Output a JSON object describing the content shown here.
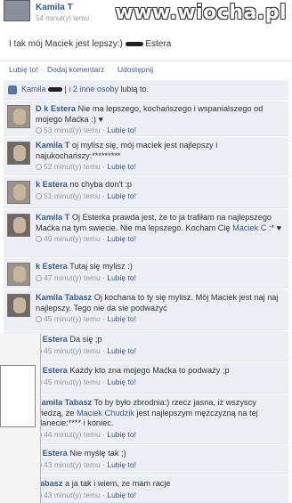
{
  "post": {
    "author": "Kamila T",
    "time": "54 minut(y) temu",
    "text_before": "I tak mój Maciek jest lepszy:)",
    "text_after": "Estera"
  },
  "watermark": "www.wiocha.pl",
  "actions": {
    "like": "Lubię to!",
    "comment": "Dodaj komentarz",
    "share": "Udostępnij"
  },
  "likes": {
    "name": "Kamila",
    "rest": "i 2 inne osoby",
    "suffix": "lubią to."
  },
  "comments": [
    {
      "name": "D     k Estera",
      "text": "Nie ma lepszego, kochańszego i wspanialszego od mojego Maćka :) ♥",
      "time": "53 minut(y) temu",
      "like": "Lubię to!"
    },
    {
      "name": "Kamila T",
      "text": "oj mylisz się, mój maciek jest najlepszy i najukochańszy:*********",
      "time": "52 minut(y) temu",
      "like": "Lubię to!"
    },
    {
      "name": "k Estera",
      "text": "no chyba don't :p",
      "time": "51 minut(y) temu",
      "like": "Lubię to!"
    },
    {
      "name": "Kamila T",
      "text": "Oj Esterka prawda jest, że to ja trafiłam na najlepszego Maćka na tym swiecie. Nie ma lepszego. Kocham Cię",
      "mention": "Maciek C",
      "text_end": ":* ♥",
      "time": "49 minut(y) temu",
      "like": "Lubię to!"
    },
    {
      "name": "k Estera",
      "text": "Tutaj się mylisz :)",
      "time": "47 minut(y) temu",
      "like": "Lubię to!"
    },
    {
      "name": "Kamila Tabasz",
      "text": "Oj kochana to ty się mylisz. Mój Maciek jest naj naj najlepszy. Tego nie da sie podważyć",
      "time": "45 minut(y) temu",
      "like": "Lubię to!"
    },
    {
      "name": "k Estera",
      "text": "Da się ;p",
      "time": "45 minut(y) temu",
      "like": "Lubię to!"
    },
    {
      "name": "k Estera",
      "text": "Każdy kto zna mojego Maćka to podważy ;p",
      "time": "45 minut(y) temu",
      "like": "Lubię to!"
    },
    {
      "name": "Kamila Tabasz",
      "text": "To by było zbrodnia:) rzecz jasna, iż wszyscy wiedzą, że",
      "mention": "Maciek Chudzik",
      "text_end": "jest najlepszym mężczyzną na tej planecie:**** i koniec.",
      "time": "44 minut(y) temu",
      "like": "Lubię to!"
    },
    {
      "name": "k Estera",
      "text": "Nie myślę tak ;)",
      "time": "43 minut(y) temu",
      "like": "Lubię to!"
    },
    {
      "name": "Tabasz",
      "text": "a ja tak i wiem, ze mam racje",
      "time": "43 minut(y) temu",
      "like": "Lubię to!"
    }
  ]
}
